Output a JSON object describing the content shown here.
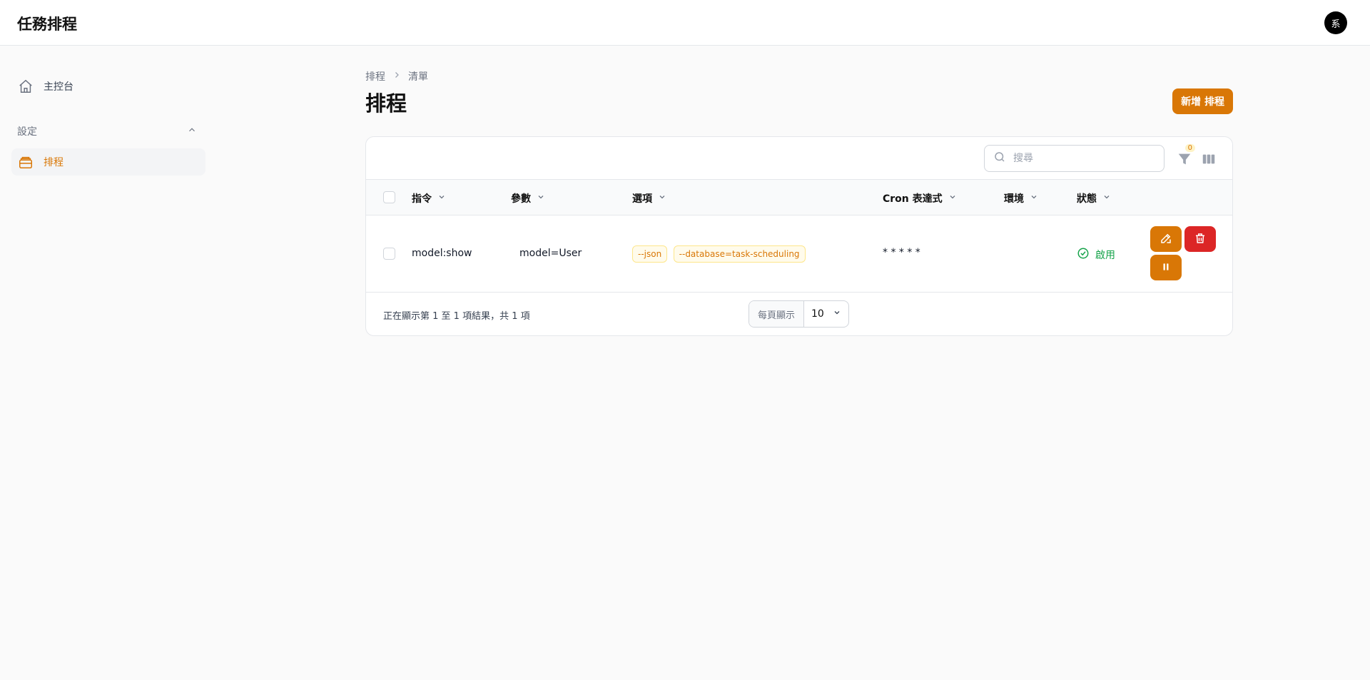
{
  "app": {
    "title": "任務排程",
    "avatar_initial": "系"
  },
  "sidebar": {
    "dashboard_label": "主控台",
    "group_label": "設定",
    "schedule_label": "排程"
  },
  "breadcrumb": {
    "root": "排程",
    "current": "清單"
  },
  "page": {
    "title": "排程",
    "new_button": "新增 排程"
  },
  "toolbar": {
    "search_placeholder": "搜尋",
    "filter_count": "0"
  },
  "table": {
    "columns": [
      "指令",
      "參數",
      "選項",
      "Cron 表達式",
      "環境",
      "狀態"
    ],
    "rows": [
      {
        "command": "model:show",
        "params": "model=User",
        "options": [
          "--json",
          "--database=task-scheduling"
        ],
        "cron": "* * * * *",
        "environment": "",
        "status": "啟用"
      }
    ]
  },
  "pagination": {
    "summary": "正在顯示第 1 至 1 項結果，共 1 項",
    "per_page_label": "每頁顯示",
    "per_page_value": "10"
  },
  "colors": {
    "accent": "#d97706",
    "danger": "#dc2626",
    "success": "#16a34a"
  }
}
